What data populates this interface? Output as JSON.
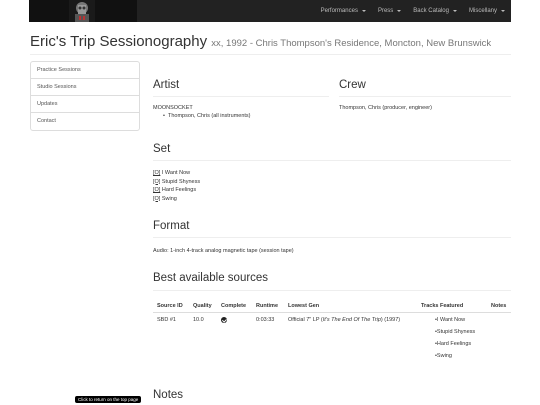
{
  "nav": {
    "items": [
      {
        "label": "Performances"
      },
      {
        "label": "Press"
      },
      {
        "label": "Back Catalog"
      },
      {
        "label": "Miscellany"
      }
    ]
  },
  "header": {
    "title": "Eric's Trip Sessionography",
    "subtitle": "xx, 1992 - Chris Thompson's Residence, Moncton, New Brunswick"
  },
  "sidebar": {
    "items": [
      {
        "label": "Practice Sessions"
      },
      {
        "label": "Studio Sessions"
      },
      {
        "label": "Updates"
      },
      {
        "label": "Contact"
      }
    ]
  },
  "artist": {
    "heading": "Artist",
    "name": "MOONSOCKET",
    "member": "Thompson, Chris (all instruments)"
  },
  "crew": {
    "heading": "Crew",
    "member": "Thompson, Chris (producer, engineer)"
  },
  "set": {
    "heading": "Set",
    "items": [
      {
        "marker": "[O]",
        "title": "I Want Now"
      },
      {
        "marker": "[O]",
        "title": "Stupid Shyness"
      },
      {
        "marker": "[O]",
        "title": "Hard Feelings"
      },
      {
        "marker": "[O]",
        "title": "Swing"
      }
    ]
  },
  "format": {
    "heading": "Format",
    "text": "Audio: 1-inch 4-track analog magnetic tape (session tape)"
  },
  "sources": {
    "heading": "Best available sources",
    "columns": [
      "Source ID",
      "Quality",
      "Complete",
      "Runtime",
      "Lowest Gen",
      "Tracks Featured",
      "Notes"
    ],
    "rows": [
      {
        "source_id": "SBD #1",
        "quality": "10.0",
        "complete_icon": "check-circle-icon",
        "runtime": "0:03:33",
        "lowest_gen_prefix": "Official 7\" LP (",
        "lowest_gen_title": "It's The End Of The Trip",
        "lowest_gen_suffix": ") (1997)",
        "tracks": [
          "•I Want Now",
          "•Stupid Shyness",
          "•Hard Feelings",
          "•Swing"
        ],
        "notes": ""
      }
    ]
  },
  "notes": {
    "heading": "Notes"
  },
  "tooltip": "Click to return on the top page"
}
